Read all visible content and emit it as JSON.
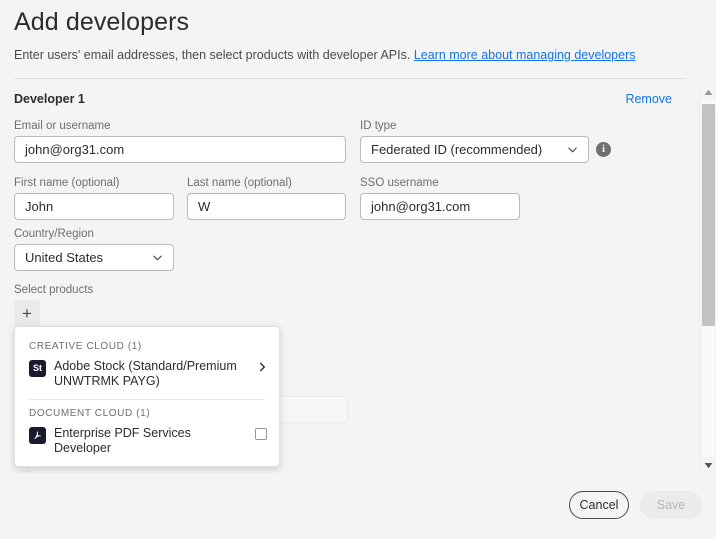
{
  "header": {
    "title": "Add developers",
    "subtitle_text": "Enter users' email addresses, then select products with developer APIs.",
    "subtitle_link": "Learn more about managing developers"
  },
  "developer": {
    "section_title": "Developer 1",
    "remove_label": "Remove",
    "fields": {
      "email_label": "Email or username",
      "email_value": "john@org31.com",
      "first_name_label": "First name (optional)",
      "first_name_value": "John",
      "last_name_label": "Last name (optional)",
      "last_name_value": "W",
      "country_label": "Country/Region",
      "country_value": "United States",
      "id_type_label": "ID type",
      "id_type_value": "Federated ID (recommended)",
      "sso_label": "SSO username",
      "sso_value": "john@org31.com"
    },
    "products_label": "Select products",
    "add_product_label": "+"
  },
  "developer_next": {
    "add_developer_label": "+"
  },
  "product_popup": {
    "groups": [
      {
        "label": "CREATIVE CLOUD (1)",
        "items": [
          {
            "icon_text": "St",
            "icon_name": "adobe-stock-icon",
            "name": "Adobe Stock (Standard/Premium UNWTRMK PAYG)",
            "control": "chevron"
          }
        ]
      },
      {
        "label": "DOCUMENT CLOUD (1)",
        "items": [
          {
            "icon_text": "↯",
            "icon_name": "acrobat-pdf-icon",
            "name": "Enterprise PDF Services Developer",
            "control": "checkbox"
          }
        ]
      }
    ]
  },
  "scrollbar": {
    "up_arrow": "▲",
    "down_arrow": "▼"
  },
  "footer": {
    "cancel_label": "Cancel",
    "save_label": "Save"
  },
  "colors": {
    "accent_link": "#1473e6",
    "page_bg": "#f4f4f4",
    "field_border": "#b9b9b9",
    "label_text": "#6e6e6e",
    "product_icon_bg": "#1a1a2e",
    "save_disabled_text": "#b6b6b6"
  }
}
